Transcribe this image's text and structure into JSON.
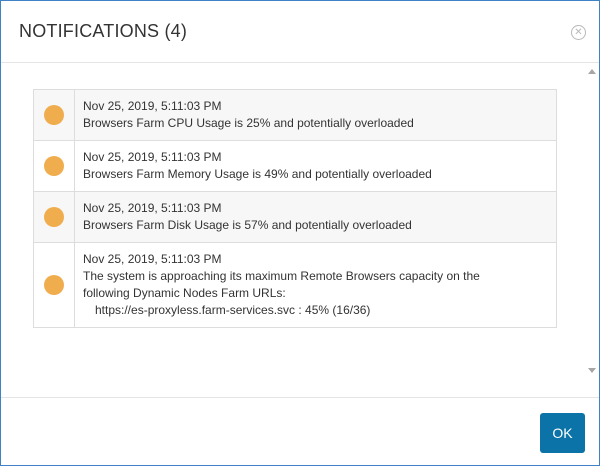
{
  "dialog": {
    "title": "NOTIFICATIONS (4)",
    "close_icon": "close-circle-icon",
    "ok_label": "OK"
  },
  "notifications": [
    {
      "timestamp": "Nov 25, 2019, 5:11:03 PM",
      "message": "Browsers Farm CPU Usage is 25% and potentially overloaded",
      "status_color": "#f0ad4e"
    },
    {
      "timestamp": "Nov 25, 2019, 5:11:03 PM",
      "message": "Browsers Farm Memory Usage is 49% and potentially overloaded",
      "status_color": "#f0ad4e"
    },
    {
      "timestamp": "Nov 25, 2019, 5:11:03 PM",
      "message": "Browsers Farm Disk Usage is 57% and potentially overloaded",
      "status_color": "#f0ad4e"
    },
    {
      "timestamp": "Nov 25, 2019, 5:11:03 PM",
      "message_line1": "The system is approaching its maximum Remote Browsers capacity on the",
      "message_line2": "following Dynamic Nodes Farm URLs:",
      "message_line3": "https://es-proxyless.farm-services.svc : 45% (16/36)",
      "status_color": "#f0ad4e"
    }
  ],
  "colors": {
    "accent": "#0b73a8",
    "border": "#3f82c5",
    "warning": "#f0ad4e"
  }
}
